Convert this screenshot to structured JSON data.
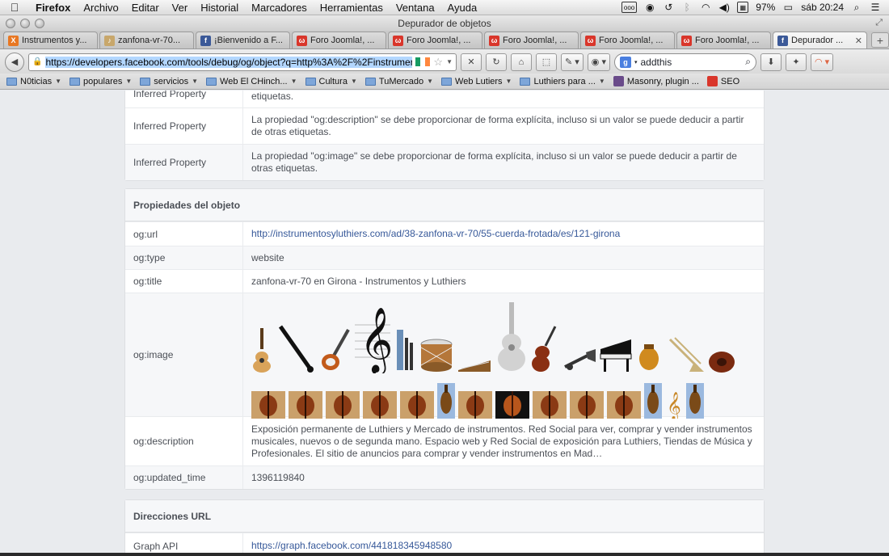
{
  "menubar": {
    "apple": "",
    "app": "Firefox",
    "items": [
      "Archivo",
      "Editar",
      "Ver",
      "Historial",
      "Marcadores",
      "Herramientas",
      "Ventana",
      "Ayuda"
    ],
    "battery": "97%",
    "clock": "sáb 20:24"
  },
  "window": {
    "title": "Depurador de objetos"
  },
  "tabs": [
    {
      "label": "Instrumentos y...",
      "favicon_color": "#e87722",
      "favicon": "X"
    },
    {
      "label": "zanfona-vr-70...",
      "favicon_color": "#c8a76b",
      "favicon": "♪"
    },
    {
      "label": "¡Bienvenido a F...",
      "favicon_color": "#3b5998",
      "favicon": "f"
    },
    {
      "label": "Foro Joomla!, ...",
      "favicon_color": "#d9362b",
      "favicon": "ω"
    },
    {
      "label": "Foro Joomla!, ...",
      "favicon_color": "#d9362b",
      "favicon": "ω"
    },
    {
      "label": "Foro Joomla!, ...",
      "favicon_color": "#d9362b",
      "favicon": "ω"
    },
    {
      "label": "Foro Joomla!, ...",
      "favicon_color": "#d9362b",
      "favicon": "ω"
    },
    {
      "label": "Foro Joomla!, ...",
      "favicon_color": "#d9362b",
      "favicon": "ω"
    },
    {
      "label": "Depurador ...",
      "favicon_color": "#3b5998",
      "favicon": "f",
      "active": true
    }
  ],
  "nav": {
    "url": "https://developers.facebook.com/tools/debug/og/object?q=http%3A%2F%2Finstrument",
    "search_value": "addthis"
  },
  "bookmarks": [
    {
      "label": "N0ticias",
      "type": "folder"
    },
    {
      "label": "populares",
      "type": "folder"
    },
    {
      "label": "servicios",
      "type": "folder"
    },
    {
      "label": "Web El CHinch...",
      "type": "folder"
    },
    {
      "label": "Cultura",
      "type": "folder"
    },
    {
      "label": "TuMercado",
      "type": "folder"
    },
    {
      "label": "Web Lutiers",
      "type": "folder"
    },
    {
      "label": "Luthiers para ...",
      "type": "folder"
    },
    {
      "label": "Masonry, plugin ...",
      "type": "link",
      "favicon_color": "#6a4b8a"
    },
    {
      "label": "SEO",
      "type": "link",
      "favicon_color": "#d9362b"
    }
  ],
  "warnings": {
    "rows": [
      {
        "key": "Inferred Property",
        "value": "etiquetas."
      },
      {
        "key": "Inferred Property",
        "value": "La propiedad \"og:description\" se debe proporcionar de forma explícita, incluso si un valor se puede deducir a partir de otras etiquetas."
      },
      {
        "key": "Inferred Property",
        "value": "La propiedad \"og:image\" se debe proporcionar de forma explícita, incluso si un valor se puede deducir a partir de otras etiquetas."
      }
    ]
  },
  "properties": {
    "heading": "Propiedades del objeto",
    "og_url_key": "og:url",
    "og_url": "http://instrumentosyluthiers.com/ad/38-zanfona-vr-70/55-cuerda-frotada/es/121-girona",
    "og_type_key": "og:type",
    "og_type": "website",
    "og_title_key": "og:title",
    "og_title": "zanfona-vr-70 en Girona - Instrumentos y Luthiers",
    "og_image_key": "og:image",
    "og_description_key": "og:description",
    "og_description": "Exposición permanente de Luthiers y Mercado de instrumentos. Red Social para ver, comprar y vender instrumentos musicales, nuevos o de segunda mano. Espacio web y Red Social de exposición para Luthiers, Tiendas de Música y Profesionales. El sitio de anuncios para comprar y vender instrumentos en Mad…",
    "og_updated_key": "og:updated_time",
    "og_updated": "1396119840"
  },
  "images_row1": [
    "guitar",
    "clarinet",
    "electric-guitar",
    "treble-clef",
    "bagpipe",
    "drum",
    "zither",
    "acoustic-guitar",
    "violin",
    "trumpet",
    "piano",
    "hurdy-gurdy",
    "trombone",
    "cello"
  ],
  "images_row2": [
    "violin-photo",
    "violin-photo",
    "violin-photo",
    "violin-photo",
    "violin-photo",
    "hurdy-gurdy-photo",
    "violin-photo",
    "violin-photo-dark",
    "violin-photo",
    "violin-photo",
    "violin-photo",
    "hurdy-gurdy-photo",
    "treble-clef-small",
    "hurdy-gurdy-photo"
  ],
  "urls": {
    "heading": "Direcciones URL",
    "graph_key": "Graph API",
    "graph_value": "https://graph.facebook.com/441818345948580"
  }
}
